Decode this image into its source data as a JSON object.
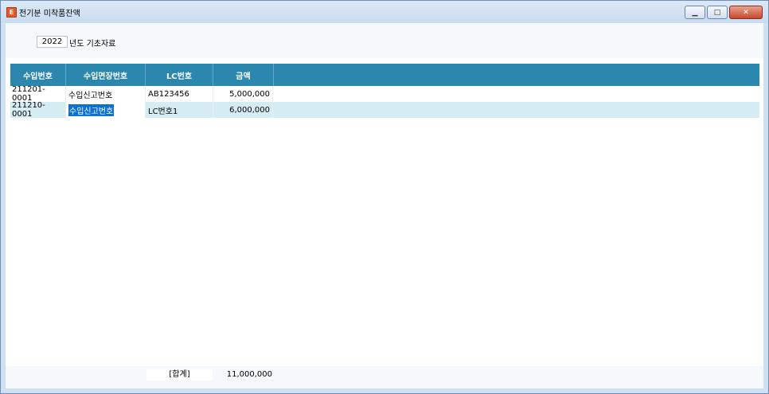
{
  "window": {
    "title": "전기분 미착품잔액",
    "app_icon": "app-logo-icon",
    "controls": [
      "minimize-icon",
      "maximize-icon",
      "close-icon"
    ]
  },
  "filter": {
    "year": "2022",
    "year_label": "년도 기초자료"
  },
  "grid": {
    "columns": [
      "수입번호",
      "수입면장번호",
      "LC번호",
      "금액"
    ],
    "rows": [
      {
        "import_no": "211201-0001",
        "customs_no": "수입신고번호",
        "lc_no": "AB123456",
        "amount": "5,000,000"
      },
      {
        "import_no": "211210-0001",
        "customs_no": "수입신고번호",
        "lc_no": "LC번호1",
        "amount": "6,000,000"
      }
    ]
  },
  "footer": {
    "sum_label": "[합계]",
    "sum_value": "11,000,000"
  },
  "colors": {
    "header_bg": "#2b87ae",
    "selected_row_bg": "#d6ecf3",
    "selection_highlight": "#0c6fd4"
  }
}
